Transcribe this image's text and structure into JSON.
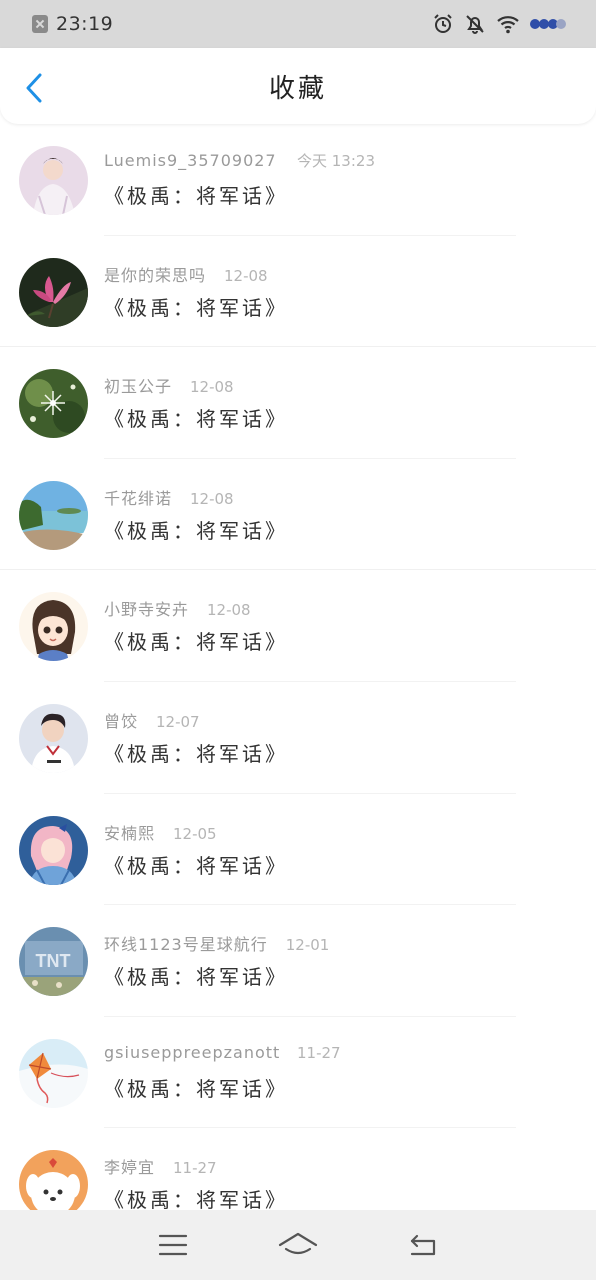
{
  "status_bar": {
    "time": "23:19"
  },
  "header": {
    "title": "收藏"
  },
  "items": [
    {
      "username": "Luemis9_35709027 ...",
      "time": "今天 13:23",
      "book": "《极禹：将军话》",
      "avatar": "avatar-person-white"
    },
    {
      "username": "是你的荣思吗",
      "time": "12-08",
      "book": "《极禹：将军话》",
      "avatar": "avatar-magnolia"
    },
    {
      "username": "初玉公子",
      "time": "12-08",
      "book": "《极禹：将军话》",
      "avatar": "avatar-dandelion"
    },
    {
      "username": "千花绯诺",
      "time": "12-08",
      "book": "《极禹：将军话》",
      "avatar": "avatar-seaside"
    },
    {
      "username": "小野寺安卉",
      "time": "12-08",
      "book": "《极禹：将军话》",
      "avatar": "avatar-anime-girl"
    },
    {
      "username": "曾饺",
      "time": "12-07",
      "book": "《极禹：将军话》",
      "avatar": "avatar-person-jersey"
    },
    {
      "username": "安楠熙",
      "time": "12-05",
      "book": "《极禹：将军话》",
      "avatar": "avatar-pink-hair"
    },
    {
      "username": "环线1123号星球航行",
      "time": "12-01",
      "book": "《极禹：将军话》",
      "avatar": "avatar-tnt-sign"
    },
    {
      "username": "gsiuseppreepzanotti",
      "time": "11-27",
      "book": "《极禹：将军话》",
      "avatar": "avatar-kite"
    },
    {
      "username": "李婷宜",
      "time": "11-27",
      "book": "《极禹：将军话》",
      "avatar": "avatar-puppy"
    }
  ],
  "colors": {
    "accent": "#1e90e6",
    "status_bar_bg": "#d9d9d9",
    "nav_bar_bg": "#f0f0f0"
  },
  "nav": {
    "icons": [
      "menu-icon",
      "home-icon",
      "back-icon"
    ]
  }
}
